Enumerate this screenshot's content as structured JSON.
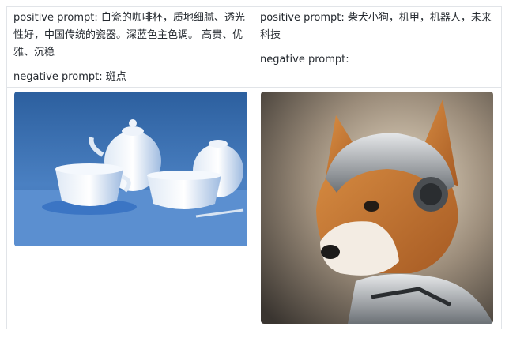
{
  "rows": [
    {
      "left": {
        "positive": "positive prompt: 白瓷的咖啡杯，质地细腻、透光性好，中国传统的瓷器。深蓝色主色调。 高贵、优雅、沉稳",
        "negative": "negative prompt: 斑点",
        "image_icon": "porcelain-teaset-image"
      },
      "right": {
        "positive": "positive prompt: 柴犬小狗，机甲，机器人，未来科技",
        "negative": "negative prompt:",
        "image_icon": "robot-shiba-image"
      }
    }
  ],
  "colors": {
    "border": "#e1e4e8",
    "text": "#24292f",
    "left_accent": "#2f6db3",
    "right_accent": "#c47a36"
  }
}
